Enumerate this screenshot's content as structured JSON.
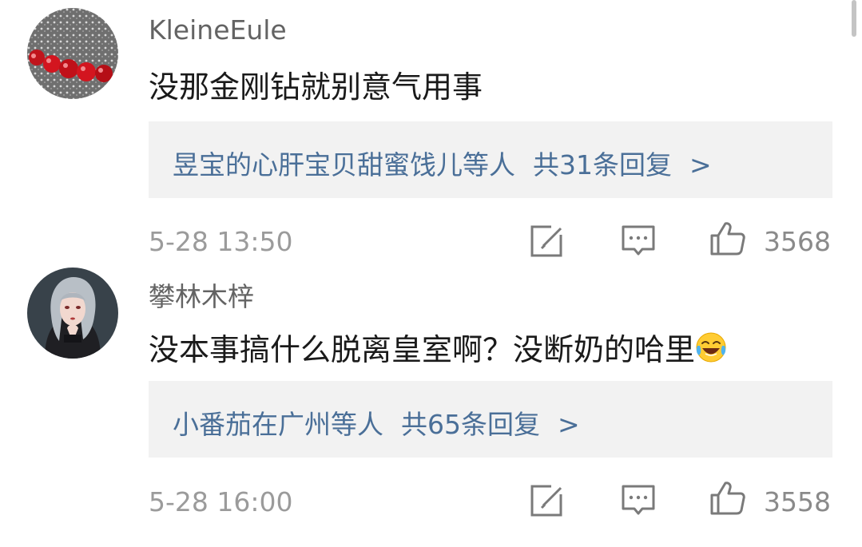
{
  "comments": [
    {
      "username": "KleineEule",
      "text": "没那金刚钻就别意气用事",
      "emoji": "",
      "reply_users": "昱宝的心肝宝贝甜蜜饯儿等人",
      "reply_count": "共31条回复",
      "chevron": ">",
      "time": "5-28 13:50",
      "likes": "3568",
      "avatar": "red-beads-avatar"
    },
    {
      "username": "攀林木梓",
      "text": "没本事搞什么脱离皇室啊？没断奶的哈里",
      "emoji": "laughing-crying-emoji",
      "reply_users": "小番茄在广州等人",
      "reply_count": "共65条回复",
      "chevron": ">",
      "time": "5-28 16:00",
      "likes": "3558",
      "avatar": "anime-girl-avatar"
    }
  ],
  "icons": {
    "edit": "edit-icon",
    "comment": "comment-icon",
    "like": "thumbs-up-icon"
  },
  "colors": {
    "link": "#4a6f98",
    "reply_bg": "#f2f2f2",
    "username": "#636363",
    "meta": "#9b9b9b"
  }
}
